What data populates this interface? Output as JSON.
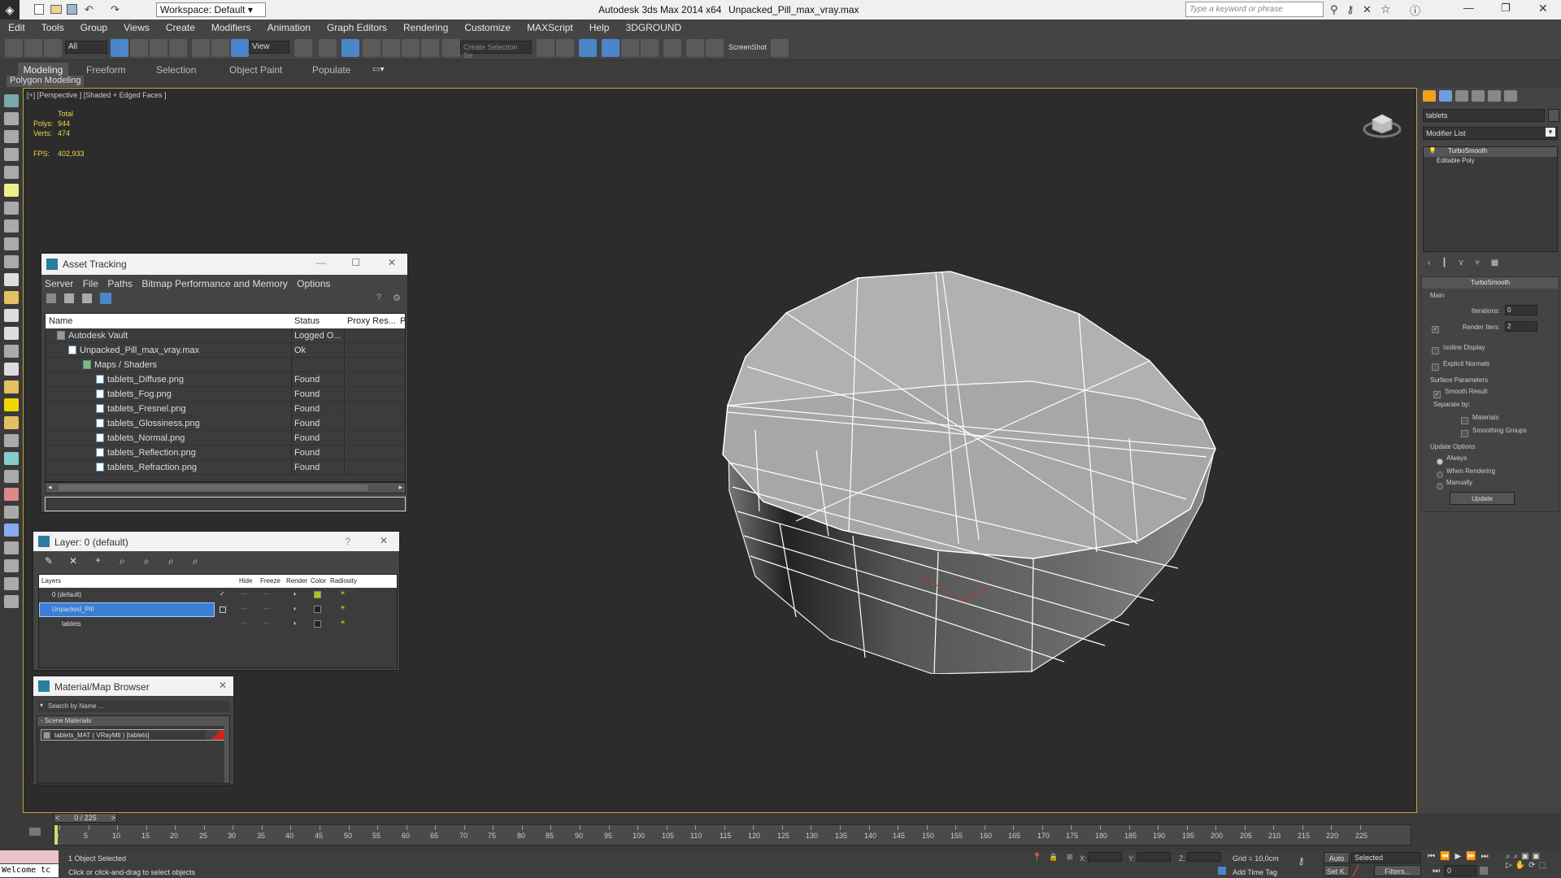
{
  "title_bar": {
    "workspace": "Workspace: Default",
    "app_title": "Autodesk 3ds Max  2014 x64",
    "file_title": "Unpacked_Pill_max_vray.max",
    "search_placeholder": "Type a keyword or phrase"
  },
  "menu": [
    "Edit",
    "Tools",
    "Group",
    "Views",
    "Create",
    "Modifiers",
    "Animation",
    "Graph Editors",
    "Rendering",
    "Customize",
    "MAXScript",
    "Help",
    "3DGROUND"
  ],
  "toolbar": {
    "filter_value": "All",
    "view_value": "View",
    "selection_set": "Create Selection Se",
    "screenshot_label": "ScreenShot"
  },
  "ribbon": {
    "tabs": [
      "Modeling",
      "Freeform",
      "Selection",
      "Object Paint",
      "Populate"
    ],
    "sub_label": "Polygon Modeling"
  },
  "viewport": {
    "label": "[+] [Perspective ] [Shaded + Edged Faces ]",
    "stats_total": "Total",
    "polys_label": "Polys:",
    "polys_value": "944",
    "verts_label": "Verts:",
    "verts_value": "474",
    "fps_label": "FPS:",
    "fps_value": "402,933"
  },
  "asset_tracking": {
    "title": "Asset Tracking",
    "menu": [
      "Server",
      "File",
      "Paths",
      "Bitmap Performance and Memory",
      "Options"
    ],
    "columns": [
      "Name",
      "Status",
      "Proxy Res...",
      "P"
    ],
    "rows": [
      {
        "name": "Autodesk Vault",
        "status": "Logged O..."
      },
      {
        "name": "Unpacked_Pill_max_vray.max",
        "status": "Ok"
      },
      {
        "name": "Maps / Shaders",
        "status": ""
      },
      {
        "name": "tablets_Diffuse.png",
        "status": "Found"
      },
      {
        "name": "tablets_Fog.png",
        "status": "Found"
      },
      {
        "name": "tablets_Fresnel.png",
        "status": "Found"
      },
      {
        "name": "tablets_Glossiness.png",
        "status": "Found"
      },
      {
        "name": "tablets_Normal.png",
        "status": "Found"
      },
      {
        "name": "tablets_Reflection.png",
        "status": "Found"
      },
      {
        "name": "tablets_Refraction.png",
        "status": "Found"
      }
    ]
  },
  "layer_window": {
    "title": "Layer: 0 (default)",
    "help": "?",
    "columns": [
      "Layers",
      "Hide",
      "Freeze",
      "Render",
      "Color",
      "Radiosity"
    ],
    "rows": [
      {
        "name": "0 (default)",
        "color": "#b8c21a"
      },
      {
        "name": "Unpacked_Pill",
        "color": "#222222"
      },
      {
        "name": "tablets",
        "color": "#222222"
      }
    ]
  },
  "material_browser": {
    "title": "Material/Map Browser",
    "search_placeholder": "Search by Name ...",
    "section": "- Scene Materials",
    "item": "tablets_MAT ( VRayMtl ) [tablets]"
  },
  "command_panel": {
    "object_name": "tablets",
    "modifier_list": "Modifier List",
    "stack": [
      "TurboSmooth",
      "Editable Poly"
    ],
    "rollout_title": "TurboSmooth",
    "main_label": "Main",
    "iterations_label": "Iterations:",
    "iterations_value": "0",
    "render_iters_label": "Render Iters:",
    "render_iters_value": "2",
    "isoline_label": "Isoline Display",
    "explicit_normals_label": "Explicit Normals",
    "surface_params_label": "Surface Parameters",
    "smooth_result_label": "Smooth Result",
    "separate_by_label": "Separate by:",
    "materials_label": "Materials",
    "smoothing_groups_label": "Smoothing Groups",
    "update_options_label": "Update Options",
    "always_label": "Always",
    "when_rendering_label": "When Rendering",
    "manually_label": "Manually",
    "update_button": "Update"
  },
  "timeline": {
    "frame_label": "0 / 225",
    "ticks": [
      "0",
      "5",
      "10",
      "15",
      "20",
      "25",
      "30",
      "35",
      "40",
      "45",
      "50",
      "55",
      "60",
      "65",
      "70",
      "75",
      "80",
      "85",
      "90",
      "95",
      "100",
      "105",
      "110",
      "115",
      "120",
      "125",
      "130",
      "135",
      "140",
      "145",
      "150",
      "155",
      "160",
      "165",
      "170",
      "175",
      "180",
      "185",
      "190",
      "195",
      "200",
      "205",
      "210",
      "215",
      "220",
      "225"
    ]
  },
  "status_bar": {
    "welcome": "Welcome tc",
    "selected_count": "1 Object Selected",
    "hint": "Click or click-and-drag to select objects",
    "x_label": "X:",
    "y_label": "Y:",
    "z_label": "Z:",
    "grid": "Grid = 10,0cm",
    "add_time_tag": "Add Time Tag",
    "auto_label": "Auto",
    "set_key_label": "Set K.",
    "selected_dropdown": "Selected",
    "filters_label": "Filters...",
    "frame_value": "0"
  },
  "colors": {
    "accent_blue": "#3a7fd5",
    "viewport_border": "#c6a42d",
    "stats_yellow": "#e8d84a"
  }
}
